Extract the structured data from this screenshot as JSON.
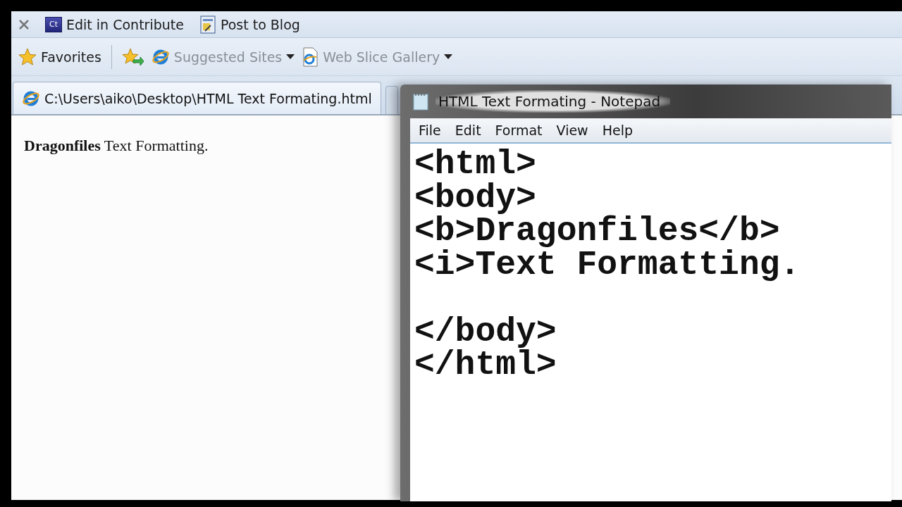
{
  "browser": {
    "command_bar": [
      {
        "kind": "contribute",
        "icon_label": "Ct",
        "label": "Edit in Contribute"
      },
      {
        "kind": "blog",
        "label": "Post to Blog"
      }
    ],
    "favorites_bar": {
      "favorites": "Favorites",
      "links": [
        {
          "label": "Suggested Sites",
          "kind": "ie"
        },
        {
          "label": "Web Slice Gallery",
          "kind": "page"
        }
      ]
    },
    "tabs": [
      {
        "label": "C:\\Users\\aiko\\Desktop\\HTML Text Formating.html",
        "selected": true
      }
    ],
    "page_text": "**Dragonfiles** Text Formatting."
  },
  "notepad": {
    "title": "HTML Text Formating - Notepad",
    "menu": [
      "File",
      "Edit",
      "Format",
      "View",
      "Help"
    ],
    "text": "<html>\n<body>\n<b>Dragonfiles</b>\n<i>Text Formatting.\n\n</body>\n</html>"
  }
}
